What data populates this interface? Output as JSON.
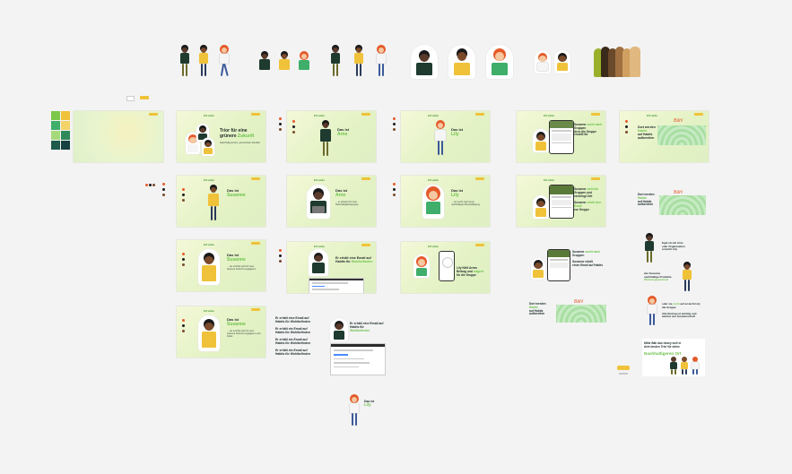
{
  "canvas": {
    "background": "#f3f3f3"
  },
  "palette": {
    "swatches": [
      "#7cc84a",
      "#f0c23a",
      "#3fae6a",
      "#f3d36a",
      "#a6d97a",
      "#2f8a5a",
      "#1f5a4a",
      "#174040"
    ]
  },
  "frames": {
    "intro": {
      "logo": "Elf utidu",
      "headline_a": "Trior für eine",
      "headline_b": "grünere",
      "headline_c": "Zukunft",
      "sub": "Nachhaltig lernen, gemeinsam handeln"
    },
    "arne": {
      "pre": "Das ist",
      "name": "Arne"
    },
    "lily": {
      "pre": "Das ist",
      "name": "Lily"
    },
    "susanne": {
      "pre": "Das ist",
      "name": "Susanne"
    },
    "arne_card": {
      "pre": "Das ist",
      "name": "Arne",
      "sub": "... er arbeitet für eine Nachhaltigkeitsgruppe"
    },
    "arne_email": {
      "line1": "Er erhält eine Email auf",
      "line2": "Habits für",
      "hl": "Wohlbefinden"
    },
    "lily_card": {
      "pre": "Das ist",
      "name": "Lily",
      "sub": "... sie sucht nach einer nachhaltigen Beschäftigung"
    },
    "lily_phone": {
      "line1": "Lily fühlt Arnes",
      "line2": "Beitrag und",
      "hl": "reagiert",
      "line3": "für die Gruppe"
    },
    "susanne_card": {
      "pre": "Das ist",
      "name": "Susanne",
      "sub": "... sie möchte sich für eine bessere Zukunft engagieren"
    },
    "susanne_card2": {
      "pre": "Das ist",
      "name": "Susanne",
      "sub": "... sie möchte sich für eine bessere Zukunft engagieren und findet"
    },
    "group": {
      "t1": "Susanne",
      "t2": "sucht nach",
      "t3": "Gruppen",
      "t4": "Arne die Gruppe",
      "t5": "erstellt für"
    },
    "group2": {
      "t1": "Susanne",
      "t2": "sieht die",
      "t3": "Gruppen und",
      "t4": "verbringt Zeit",
      "t5": "Susanne",
      "t6": "erhält eine Email",
      "t7": "zur Gruppe"
    },
    "tablet": {
      "t1": "Susanne",
      "t2": "sucht nach",
      "t3": "Gruppen",
      "t4": "Susanne erhält",
      "t5": "einen Email auf Habits"
    },
    "meadow": {
      "t1": "Dort werden",
      "t2": "Habits",
      "t3": "auf Habits",
      "t4": "aufbereiten",
      "handwriting": "Bäh!"
    },
    "meadow_bottom": {
      "t1": "Dort werden",
      "t2": "Habits",
      "t3": "auf Habits",
      "t4": "aufbereiten"
    },
    "right_col": {
      "a1": "Egal ob mit Arne",
      "a2": "oder Organisation",
      "a3": "erreicht Lily",
      "b1": "wie Susanne",
      "b2": "nachhaltige Produkte",
      "b3": "Wohnungswechsel",
      "c1": "oder sie",
      "c2": "steht",
      "c3": "auf erreicht Lily",
      "c4": "die Gruppe",
      "d1": "Alle Eintrag ist wichtig und wächst aus Gemeinschaft",
      "cta1": "Mitte Bäh das heavy weil er",
      "cta2": "dein besten Trier für deine",
      "cta3": "Nachhaltigeren Ort"
    },
    "loose_texts": [
      "Er erhält eine Email auf Habits für Wohlbefinden",
      "Er erhält ein Email auf Habits für Wohlbefinden",
      "Er erhält ein Email auf Habits für Wohlbefinden",
      "Er erhält ein Email auf Habits für Wohlbefinden"
    ],
    "email_ui": {
      "t1": "Er erhält eine Email auf",
      "t2": "Habits für",
      "hl": "Wohlbefinden"
    },
    "lily_bottom": {
      "pre": "Das ist",
      "name": "Lily"
    },
    "tiny_labels": {
      "label1": "—",
      "label2": "Label"
    }
  },
  "characters": {
    "arne": {
      "skin": "#5a3a2a",
      "shirt": "#1f3a2f",
      "pants": "#6a6a2a",
      "hair": "#1a1a1a"
    },
    "lily": {
      "skin": "#f4c8a0",
      "shirt": "#f5f5f5",
      "pants": "#3a5a9a",
      "hair": "#e55a2a"
    },
    "susanne": {
      "skin": "#7a4a2a",
      "shirt": "#f0c23a",
      "pants": "#2a3a5a",
      "hair": "#1a1a1a"
    },
    "kid": {
      "skin": "#f4c8a0",
      "shirt": "#e8c23a",
      "pants": "#3a3a3a",
      "hair": "#1a1a1a"
    }
  },
  "accent": {
    "green": "#6cc24a",
    "yellow": "#f0c23a",
    "dark": "#1c2a2a"
  }
}
